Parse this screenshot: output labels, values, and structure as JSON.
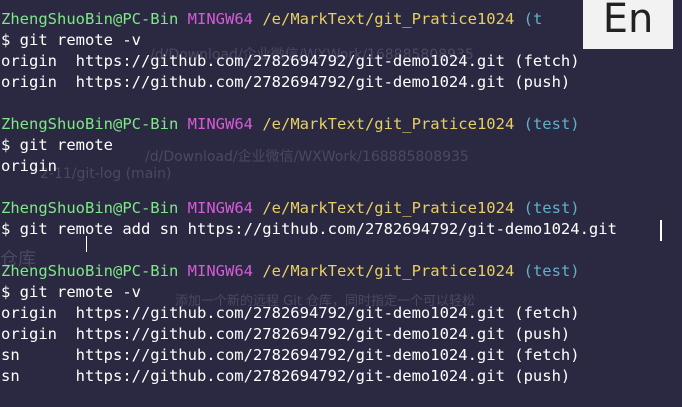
{
  "prompt": {
    "user": "ZhengShuoBin@PC-Bin",
    "env": "MINGW64",
    "path": "/e/MarkText/git_Pratice1024",
    "branch": "(test)",
    "branch_cut": "(t"
  },
  "lines": {
    "c1": "$ git remote -v",
    "o1": "origin  https://github.com/2782694792/git-demo1024.git (fetch)",
    "o2": "origin  https://github.com/2782694792/git-demo1024.git (push)",
    "c2": "$ git remote",
    "o3": "origin",
    "c3": "$ git remote add sn https://github.com/2782694792/git-demo1024.git",
    "c4": "$ git remote -v",
    "o4": "origin  https://github.com/2782694792/git-demo1024.git (fetch)",
    "o5": "origin  https://github.com/2782694792/git-demo1024.git (push)",
    "o6": "sn      https://github.com/2782694792/git-demo1024.git (fetch)",
    "o7": "sn      https://github.com/2782694792/git-demo1024.git (push)"
  },
  "background_ghost": {
    "g1": "/d/Download/企业微信/WXWork/168885808935",
    "g2": "/d/Download/企业微信/WXWork/168885808935",
    "g3": "2-11/git-log (main)",
    "g4": "仓库",
    "g5": "添加一个新的远程 Git 仓库，同时指定一个可以轻松"
  },
  "ime": {
    "label": "En"
  },
  "colors": {
    "background": "#2b2941",
    "text": "#ffffff",
    "user": "#7ee787",
    "mingw": "#d65bd8",
    "path": "#e6cf63",
    "branch": "#5fb0c9"
  }
}
